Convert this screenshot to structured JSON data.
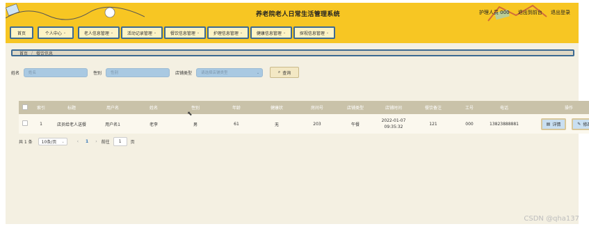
{
  "header": {
    "title": "养老院老人日常生活管理系统",
    "user": "护理人员 000",
    "back_to_front": "退出到前台",
    "logout": "退出登录"
  },
  "nav": {
    "items": [
      {
        "label": "首页",
        "has_menu": false
      },
      {
        "label": "个人中心",
        "has_menu": true
      },
      {
        "label": "老人信息管理",
        "has_menu": true
      },
      {
        "label": "活动记录管理",
        "has_menu": true
      },
      {
        "label": "餐饮信息管理",
        "has_menu": true
      },
      {
        "label": "护理信息管理",
        "has_menu": true
      },
      {
        "label": "健康信息管理",
        "has_menu": true
      },
      {
        "label": "探视信息管理",
        "has_menu": true
      }
    ]
  },
  "breadcrumb": {
    "home": "首页",
    "current": "餐饮信息"
  },
  "search": {
    "name_label": "姓名",
    "name_placeholder": "姓名",
    "gender_label": "性别",
    "gender_placeholder": "性别",
    "type_label": "店铺类型",
    "type_placeholder": "请选择店铺类型",
    "button": "查询"
  },
  "table": {
    "headers": [
      "索引",
      "标题",
      "用户名",
      "姓名",
      "性别",
      "年龄",
      "健康状",
      "房间号",
      "店铺类型",
      "店铺时间",
      "餐饮备注",
      "工号",
      "电话",
      "操作"
    ],
    "rows": [
      {
        "cells": [
          "1",
          "店员给老人送餐",
          "用户名1",
          "老李",
          "男",
          "61",
          "无",
          "203",
          "午餐",
          "2022-01-07 09:35:32",
          "121",
          "000",
          "13823888881"
        ],
        "actions": {
          "detail": "详情",
          "edit": "修改"
        }
      }
    ]
  },
  "pager": {
    "total": "共 1 条",
    "page_size": "10条/页",
    "current_page": "1",
    "goto_label": "前往",
    "goto_value": "1",
    "page_suffix": "页"
  },
  "watermark": "CSDN @qha137",
  "colors": {
    "header_bg": "#f7c623",
    "nav_border": "#3d6a92",
    "table_head": "#c9c2a9",
    "input_bg": "#a9c9e2"
  }
}
